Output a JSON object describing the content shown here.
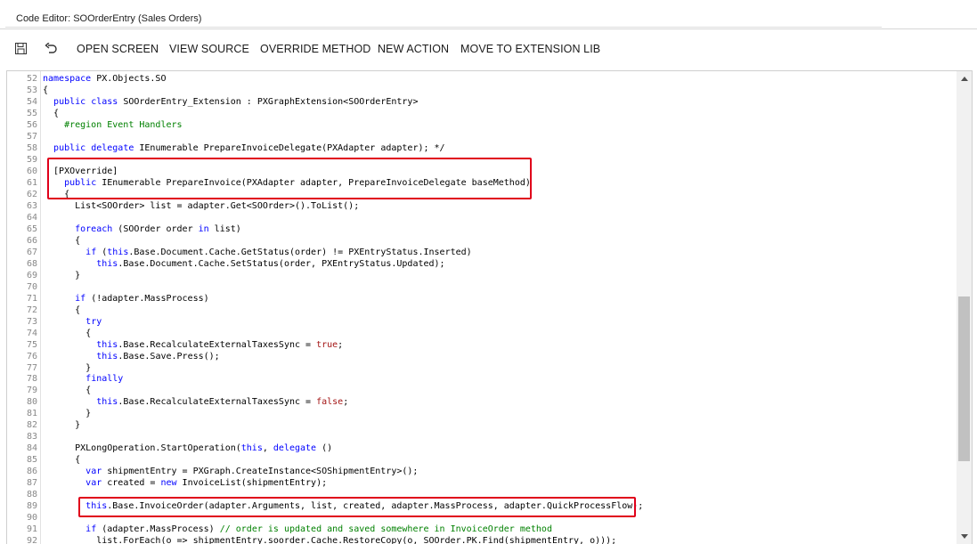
{
  "window": {
    "title": "Code Editor: SOOrderEntry (Sales Orders)"
  },
  "toolbar": {
    "save_icon": "save-icon",
    "undo_icon": "undo-icon",
    "buttons": [
      "OPEN SCREEN",
      "VIEW SOURCE",
      "OVERRIDE METHOD",
      "NEW ACTION",
      "MOVE TO EXTENSION LIB"
    ]
  },
  "editor": {
    "lines": [
      {
        "n": "52",
        "text": "namespace PX.Objects.SO"
      },
      {
        "n": "53",
        "text": "{"
      },
      {
        "n": "54",
        "text": "  public class SOOrderEntry_Extension : PXGraphExtension<SOOrderEntry>"
      },
      {
        "n": "55",
        "text": "  {"
      },
      {
        "n": "56",
        "text": "    #region Event Handlers"
      },
      {
        "n": "57",
        "text": ""
      },
      {
        "n": "58",
        "text": "  public delegate IEnumerable PrepareInvoiceDelegate(PXAdapter adapter); */"
      },
      {
        "n": "59",
        "text": ""
      },
      {
        "n": "60",
        "text": "  [PXOverride]"
      },
      {
        "n": "61",
        "text": "    public IEnumerable PrepareInvoice(PXAdapter adapter, PrepareInvoiceDelegate baseMethod)"
      },
      {
        "n": "62",
        "text": "    {"
      },
      {
        "n": "63",
        "text": "      List<SOOrder> list = adapter.Get<SOOrder>().ToList();"
      },
      {
        "n": "64",
        "text": ""
      },
      {
        "n": "65",
        "text": "      foreach (SOOrder order in list)"
      },
      {
        "n": "66",
        "text": "      {"
      },
      {
        "n": "67",
        "text": "        if (this.Base.Document.Cache.GetStatus(order) != PXEntryStatus.Inserted)"
      },
      {
        "n": "68",
        "text": "          this.Base.Document.Cache.SetStatus(order, PXEntryStatus.Updated);"
      },
      {
        "n": "69",
        "text": "      }"
      },
      {
        "n": "70",
        "text": ""
      },
      {
        "n": "71",
        "text": "      if (!adapter.MassProcess)"
      },
      {
        "n": "72",
        "text": "      {"
      },
      {
        "n": "73",
        "text": "        try"
      },
      {
        "n": "74",
        "text": "        {"
      },
      {
        "n": "75",
        "text": "          this.Base.RecalculateExternalTaxesSync = true;"
      },
      {
        "n": "76",
        "text": "          this.Base.Save.Press();"
      },
      {
        "n": "77",
        "text": "        }"
      },
      {
        "n": "78",
        "text": "        finally"
      },
      {
        "n": "79",
        "text": "        {"
      },
      {
        "n": "80",
        "text": "          this.Base.RecalculateExternalTaxesSync = false;"
      },
      {
        "n": "81",
        "text": "        }"
      },
      {
        "n": "82",
        "text": "      }"
      },
      {
        "n": "83",
        "text": ""
      },
      {
        "n": "84",
        "text": "      PXLongOperation.StartOperation(this, delegate ()"
      },
      {
        "n": "85",
        "text": "      {"
      },
      {
        "n": "86",
        "text": "        var shipmentEntry = PXGraph.CreateInstance<SOShipmentEntry>();"
      },
      {
        "n": "87",
        "text": "        var created = new InvoiceList(shipmentEntry);"
      },
      {
        "n": "88",
        "text": ""
      },
      {
        "n": "89",
        "text": "        this.Base.InvoiceOrder(adapter.Arguments, list, created, adapter.MassProcess, adapter.QuickProcessFlow);"
      },
      {
        "n": "90",
        "text": ""
      },
      {
        "n": "91",
        "text": "        if (adapter.MassProcess) // order is updated and saved somewhere in InvoiceOrder method"
      },
      {
        "n": "92",
        "text": "          list.ForEach(o => shipmentEntry.soorder.Cache.RestoreCopy(o, SOOrder.PK.Find(shipmentEntry, o)));"
      }
    ]
  },
  "colors": {
    "keyword": "#0000ff",
    "comment": "#008000",
    "type": "#2b91af",
    "highlight": "#e0001a"
  }
}
